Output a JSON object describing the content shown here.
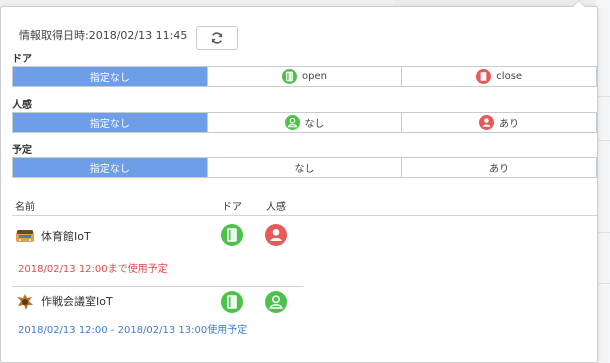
{
  "header": {
    "info_label": "情報取得日時:",
    "info_time": "2018/02/13 11:45",
    "refresh_icon": "refresh-icon"
  },
  "filters": {
    "door": {
      "title": "ドア",
      "options": [
        {
          "label": "指定なし",
          "active": true,
          "icon": ""
        },
        {
          "label": "open",
          "active": false,
          "icon": "door-open-icon"
        },
        {
          "label": "close",
          "active": false,
          "icon": "door-close-icon"
        }
      ]
    },
    "presence": {
      "title": "人感",
      "options": [
        {
          "label": "指定なし",
          "active": true,
          "icon": ""
        },
        {
          "label": "なし",
          "active": false,
          "icon": "person-absent-icon"
        },
        {
          "label": "あり",
          "active": false,
          "icon": "person-present-icon"
        }
      ]
    },
    "schedule": {
      "title": "予定",
      "options": [
        {
          "label": "指定なし",
          "active": true
        },
        {
          "label": "なし",
          "active": false
        },
        {
          "label": "あり",
          "active": false
        }
      ]
    }
  },
  "list": {
    "columns": {
      "name": "名前",
      "door": "ドア",
      "presence": "人感"
    },
    "rows": [
      {
        "name": "体育館IoT",
        "door": "open",
        "presence": "present",
        "status": "2018/02/13 12:00まで使用予定",
        "status_color": "#e24b4b"
      },
      {
        "name": "作戦会議室IoT",
        "door": "open",
        "presence": "absent",
        "status": "2018/02/13 12:00 - 2018/02/13 13:00使用予定",
        "status_color": "#3a7fcf"
      }
    ]
  },
  "colors": {
    "accent": "#6e9ee8",
    "green": "#4cc24c",
    "red": "#e85a5a"
  }
}
